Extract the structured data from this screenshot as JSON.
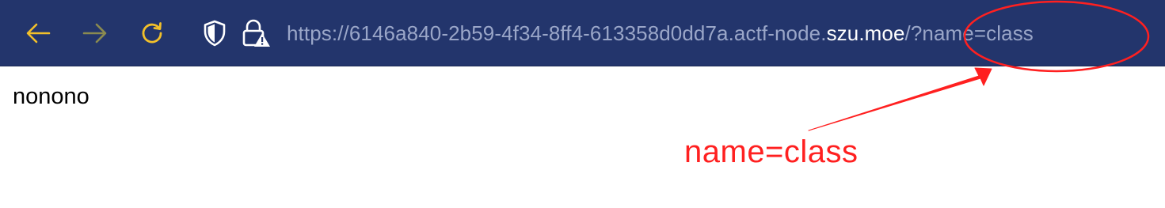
{
  "toolbar": {
    "back_icon": "arrow-left-icon",
    "forward_icon": "arrow-right-icon",
    "reload_icon": "reload-icon",
    "shield_icon": "shield-icon",
    "lock_icon": "lock-warning-icon",
    "colors": {
      "background": "#23356c",
      "nav_active": "#f2c02a",
      "nav_disabled": "#8a8a50",
      "url_dim": "#9aa6c8",
      "url_bright": "#ffffff"
    }
  },
  "urlbar": {
    "prefix": "https://6146a840-2b59-4f34-8ff4-613358d0dd7a.actf-node.",
    "domain": "szu.moe",
    "suffix": "/?name=class"
  },
  "page": {
    "body_text": "nonono"
  },
  "annotation": {
    "label": "name=class",
    "color": "#ff2020"
  }
}
